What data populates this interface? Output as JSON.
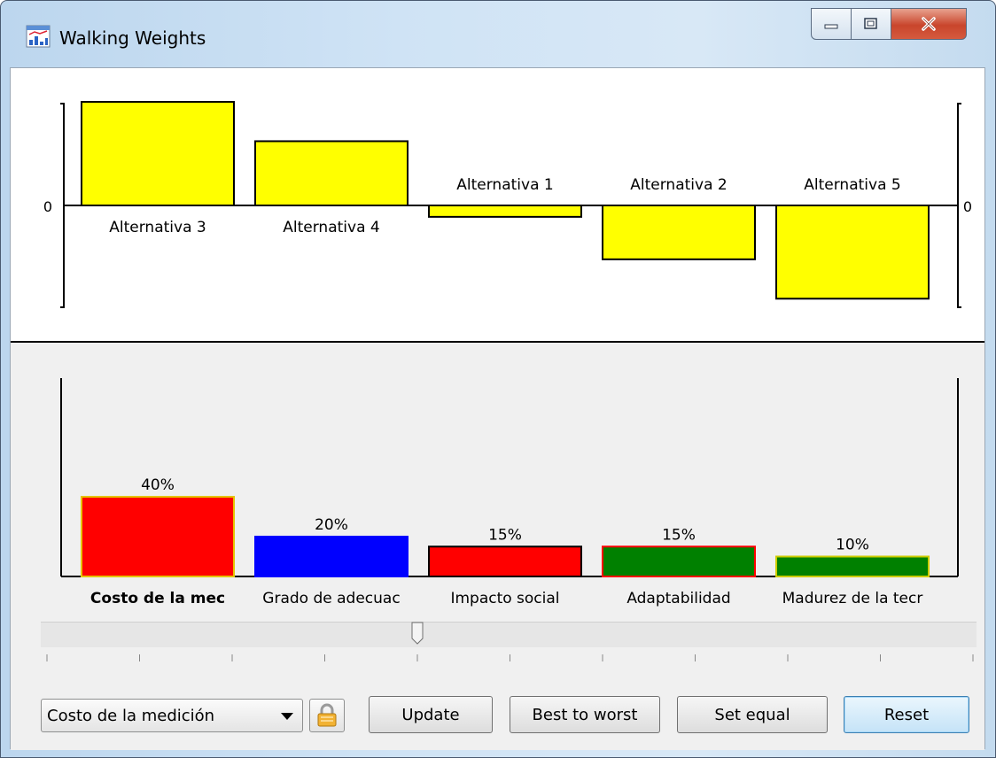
{
  "window": {
    "title": "Walking Weights",
    "controls": [
      "minimize",
      "maximize",
      "close"
    ]
  },
  "top_chart": {
    "zero_label_left": "0",
    "zero_label_right": "0",
    "fill_color": "#ffff00",
    "bars": [
      {
        "label": "Alternativa 3",
        "value": 1.0
      },
      {
        "label": "Alternativa 4",
        "value": 0.62
      },
      {
        "label": "Alternativa 1",
        "value": -0.11
      },
      {
        "label": "Alternativa 2",
        "value": -0.52
      },
      {
        "label": "Alternativa 5",
        "value": -0.9
      }
    ]
  },
  "weights_chart": {
    "bars": [
      {
        "label": "Costo de la mec",
        "value": 40,
        "value_label": "40%",
        "fill": "#ff0000",
        "border": "#e5c400",
        "bold": true
      },
      {
        "label": "Grado de adecuac",
        "value": 20,
        "value_label": "20%",
        "fill": "#0000ff",
        "border": "#0000ff",
        "bold": false
      },
      {
        "label": "Impacto social",
        "value": 15,
        "value_label": "15%",
        "fill": "#ff0000",
        "border": "#000000",
        "bold": false
      },
      {
        "label": "Adaptabilidad",
        "value": 15,
        "value_label": "15%",
        "fill": "#008000",
        "border": "#ff0000",
        "bold": false
      },
      {
        "label": "Madurez de la tecr",
        "value": 10,
        "value_label": "10%",
        "fill": "#008000",
        "border": "#cccc00",
        "bold": false
      }
    ]
  },
  "slider": {
    "value_fraction": 0.4,
    "tick_count": 11
  },
  "controls": {
    "criterion_select": "Costo de la medición",
    "lock_icon": "lock-icon",
    "update_label": "Update",
    "best_to_worst_label": "Best to worst",
    "set_equal_label": "Set equal",
    "reset_label": "Reset"
  }
}
